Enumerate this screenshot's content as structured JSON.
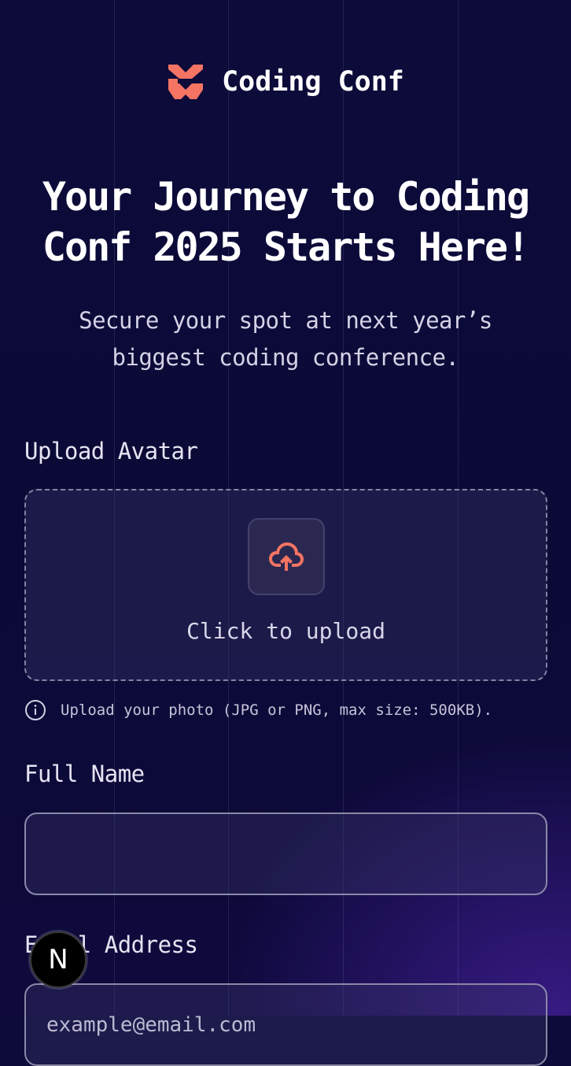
{
  "brand": {
    "name": "Coding Conf",
    "accent_color": "#f57463"
  },
  "hero": {
    "title": "Your Journey to Coding Conf 2025 Starts Here!",
    "subtitle": "Secure your spot at next year’s biggest coding conference."
  },
  "form": {
    "avatar": {
      "label": "Upload Avatar",
      "upload_text": "Click to upload",
      "icon": "cloud-upload-icon",
      "hint": "Upload your photo (JPG or PNG, max size: 500KB).",
      "hint_icon": "info-icon"
    },
    "full_name": {
      "label": "Full Name",
      "value": "",
      "placeholder": ""
    },
    "email": {
      "label": "Email Address",
      "value": "",
      "placeholder": "example@email.com"
    }
  },
  "dev_badge": {
    "letter": "N",
    "icon": "nextjs-icon"
  }
}
